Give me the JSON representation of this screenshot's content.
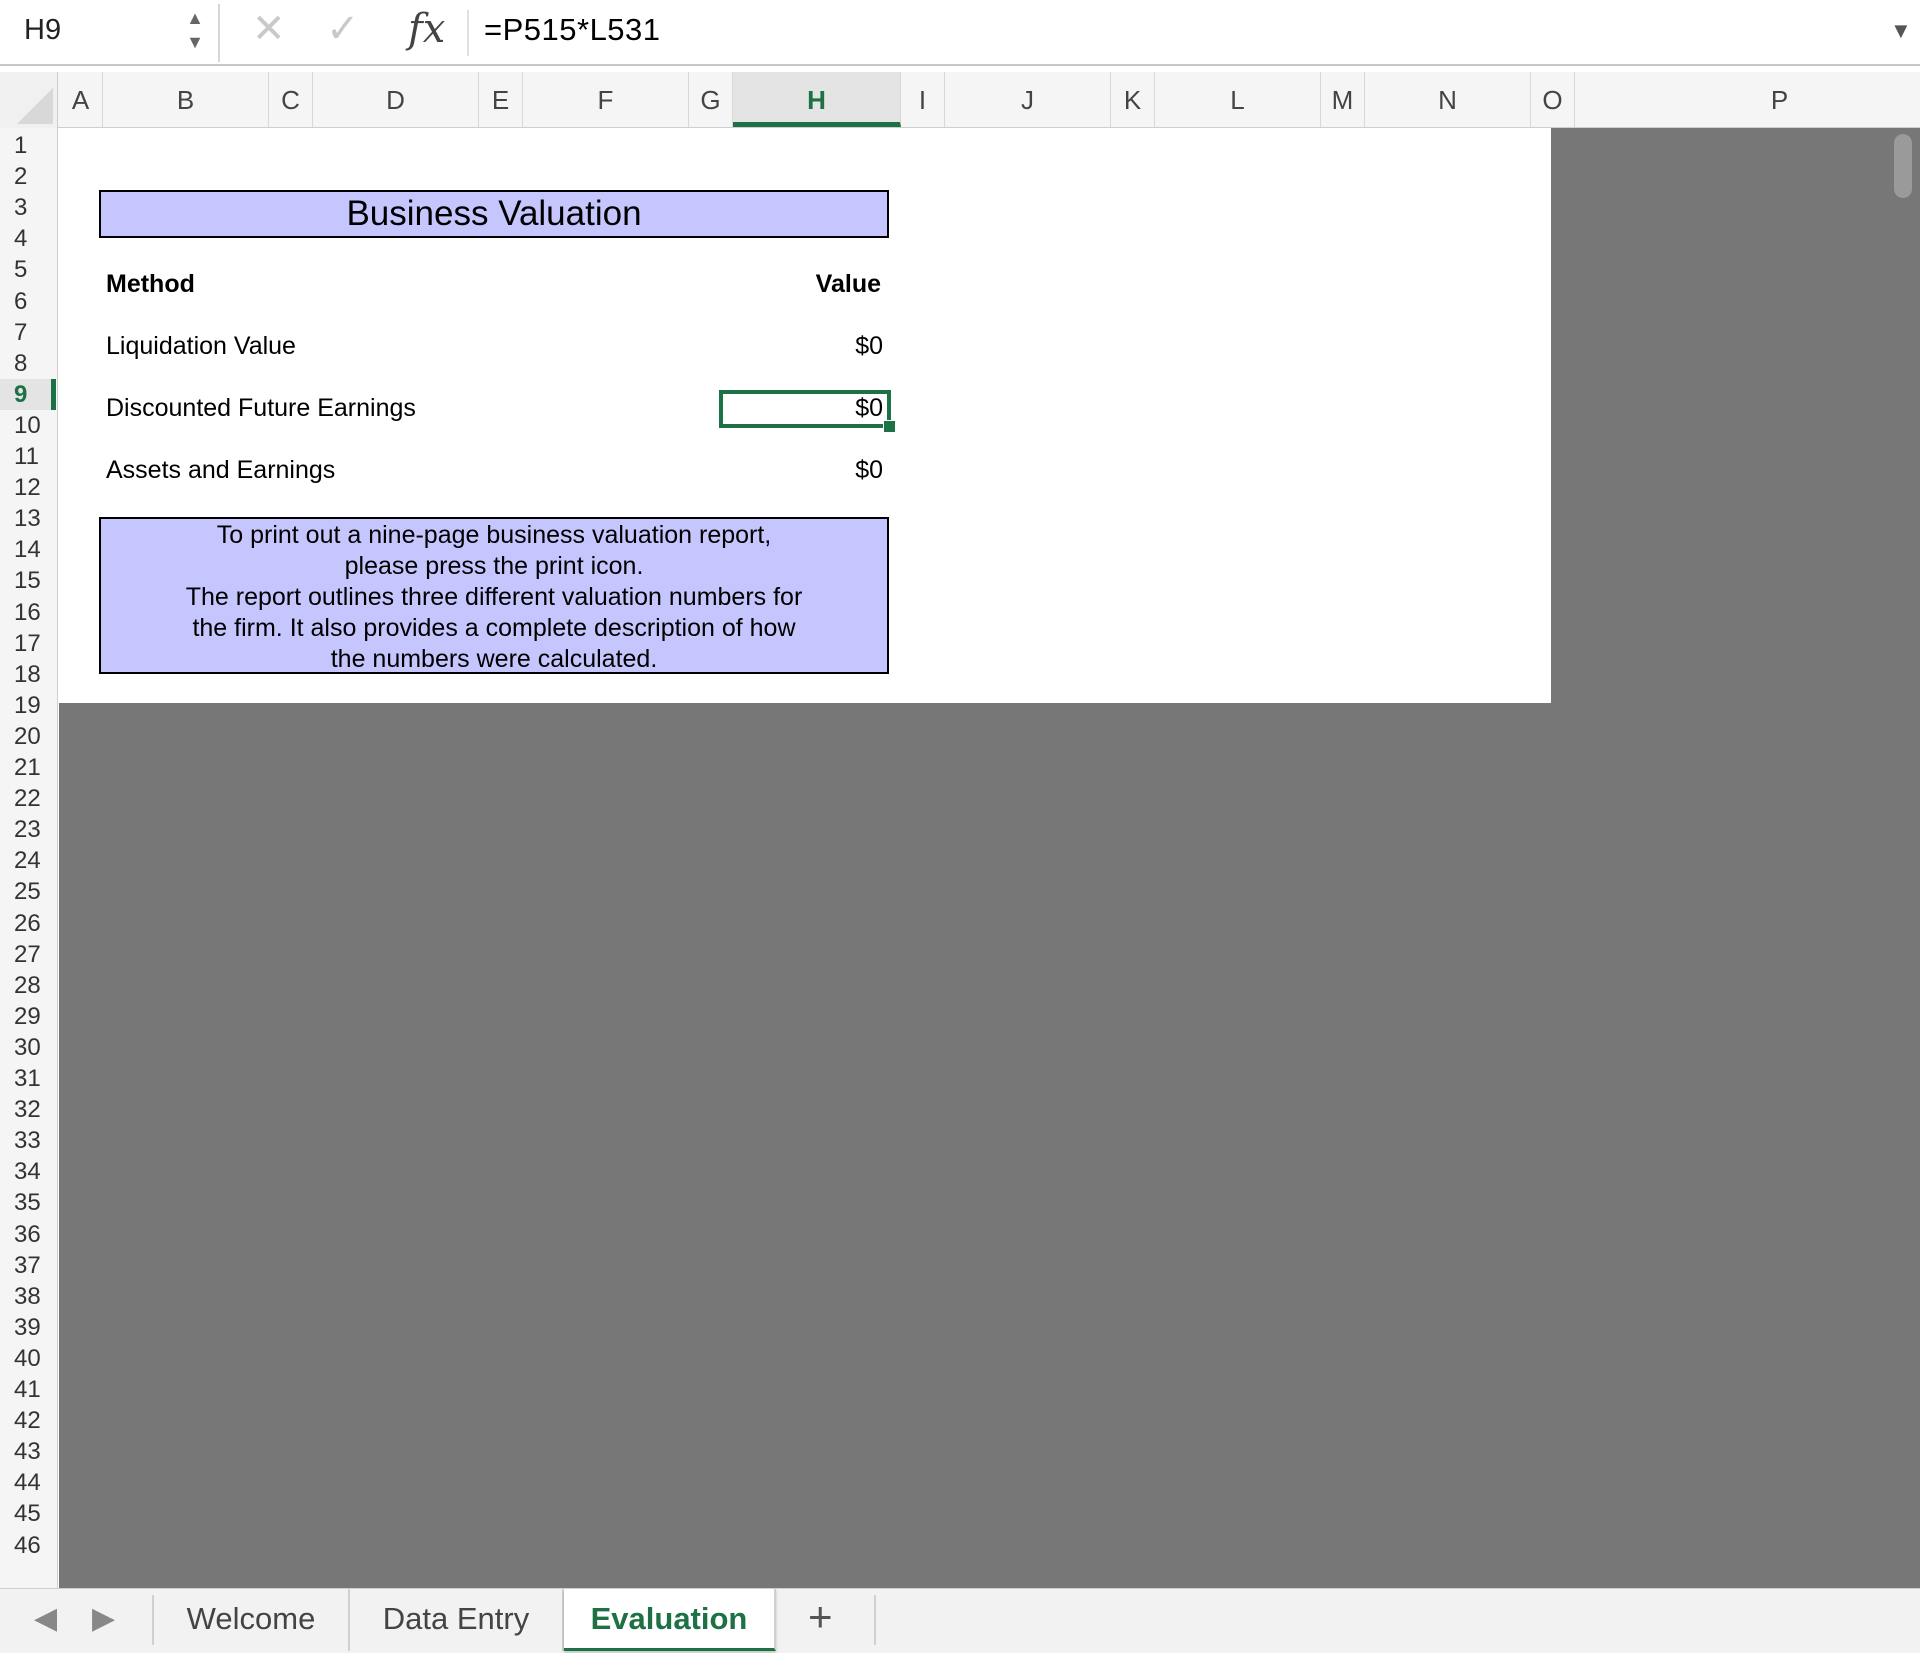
{
  "formula_bar": {
    "name_box": "H9",
    "formula": "=P515*L531",
    "fx_label": "fx",
    "icons": {
      "stepper": "up-down-stepper-icon",
      "cancel": "close-icon",
      "enter": "checkmark-icon",
      "expand": "chevron-down-icon"
    }
  },
  "columns": [
    "A",
    "B",
    "C",
    "D",
    "E",
    "F",
    "G",
    "H",
    "I",
    "J",
    "K",
    "L",
    "M",
    "N",
    "O",
    "P"
  ],
  "selected_column": "H",
  "rows": [
    "1",
    "2",
    "3",
    "4",
    "5",
    "6",
    "7",
    "8",
    "9",
    "10",
    "11",
    "12",
    "13",
    "14",
    "15",
    "16",
    "17",
    "18",
    "19",
    "20",
    "21",
    "22",
    "23",
    "24",
    "25",
    "26",
    "27",
    "28",
    "29",
    "30",
    "31",
    "32",
    "33",
    "34",
    "35",
    "36",
    "37",
    "38",
    "39",
    "40",
    "41",
    "42",
    "43",
    "44",
    "45",
    "46"
  ],
  "selected_row": "9",
  "sheet": {
    "title": "Business Valuation",
    "header_method": "Method",
    "header_value": "Value",
    "rows": [
      {
        "method": "Liquidation Value",
        "value": "$0"
      },
      {
        "method": "Discounted Future Earnings",
        "value": "$0"
      },
      {
        "method": "Assets and Earnings",
        "value": "$0"
      }
    ],
    "note_lines": [
      "To print out a nine-page business valuation report,",
      "please press the print icon.",
      "The report outlines three different valuation numbers for",
      "the firm.  It also provides a complete description of how",
      "the numbers were calculated."
    ]
  },
  "tabs": {
    "items": [
      "Welcome",
      "Data Entry",
      "Evaluation"
    ],
    "active": "Evaluation",
    "add_label": "+",
    "nav_prev_icon": "triangle-left-icon",
    "nav_next_icon": "triangle-right-icon"
  },
  "colors": {
    "accent": "#1e7145",
    "box_fill": "#c6c6ff",
    "outside_print_area": "#777777"
  }
}
